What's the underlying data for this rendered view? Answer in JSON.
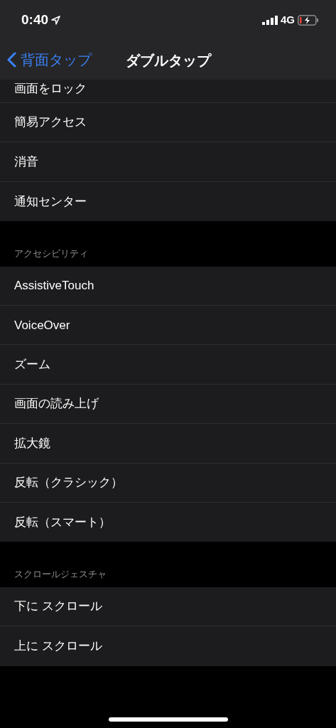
{
  "status_bar": {
    "time": "0:40",
    "network": "4G"
  },
  "nav_bar": {
    "back_label": "背面タップ",
    "title": "ダブルタップ"
  },
  "sections": [
    {
      "items": [
        "画面をロック",
        "簡易アクセス",
        "消音",
        "通知センター"
      ]
    },
    {
      "header": "アクセシビリティ",
      "items": [
        "AssistiveTouch",
        "VoiceOver",
        "ズーム",
        "画面の読み上げ",
        "拡大鏡",
        "反転（クラシック）",
        "反転（スマート）"
      ]
    },
    {
      "header": "スクロールジェスチャ",
      "items": [
        "下に スクロール",
        "上に スクロール"
      ]
    }
  ]
}
